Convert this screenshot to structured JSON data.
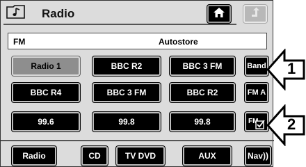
{
  "header": {
    "title": "Radio",
    "home_icon": "home-icon",
    "back_icon": "back-arrow-icon",
    "folder_icon": "music-folder-icon"
  },
  "status": {
    "band": "FM",
    "mode": "Autostore"
  },
  "presets": {
    "row1": [
      "Radio 1",
      "BBC R2",
      "BBC 3 FM"
    ],
    "row2": [
      "BBC R4",
      "BBC 3 FM",
      "BBC R2"
    ],
    "row3": [
      "99.6",
      "99.8",
      "99.8"
    ]
  },
  "side_buttons": {
    "band": "Band",
    "fm_a": "FM A",
    "fm_check": "FM"
  },
  "tabs": [
    "Radio",
    "CD",
    "TV DVD",
    "AUX",
    "Nav))"
  ],
  "callouts": [
    "1",
    "2"
  ],
  "colors": {
    "button_bg": "#000000",
    "selected_bg": "#8e8e8e",
    "screen_bg": "#dcdcdc"
  }
}
